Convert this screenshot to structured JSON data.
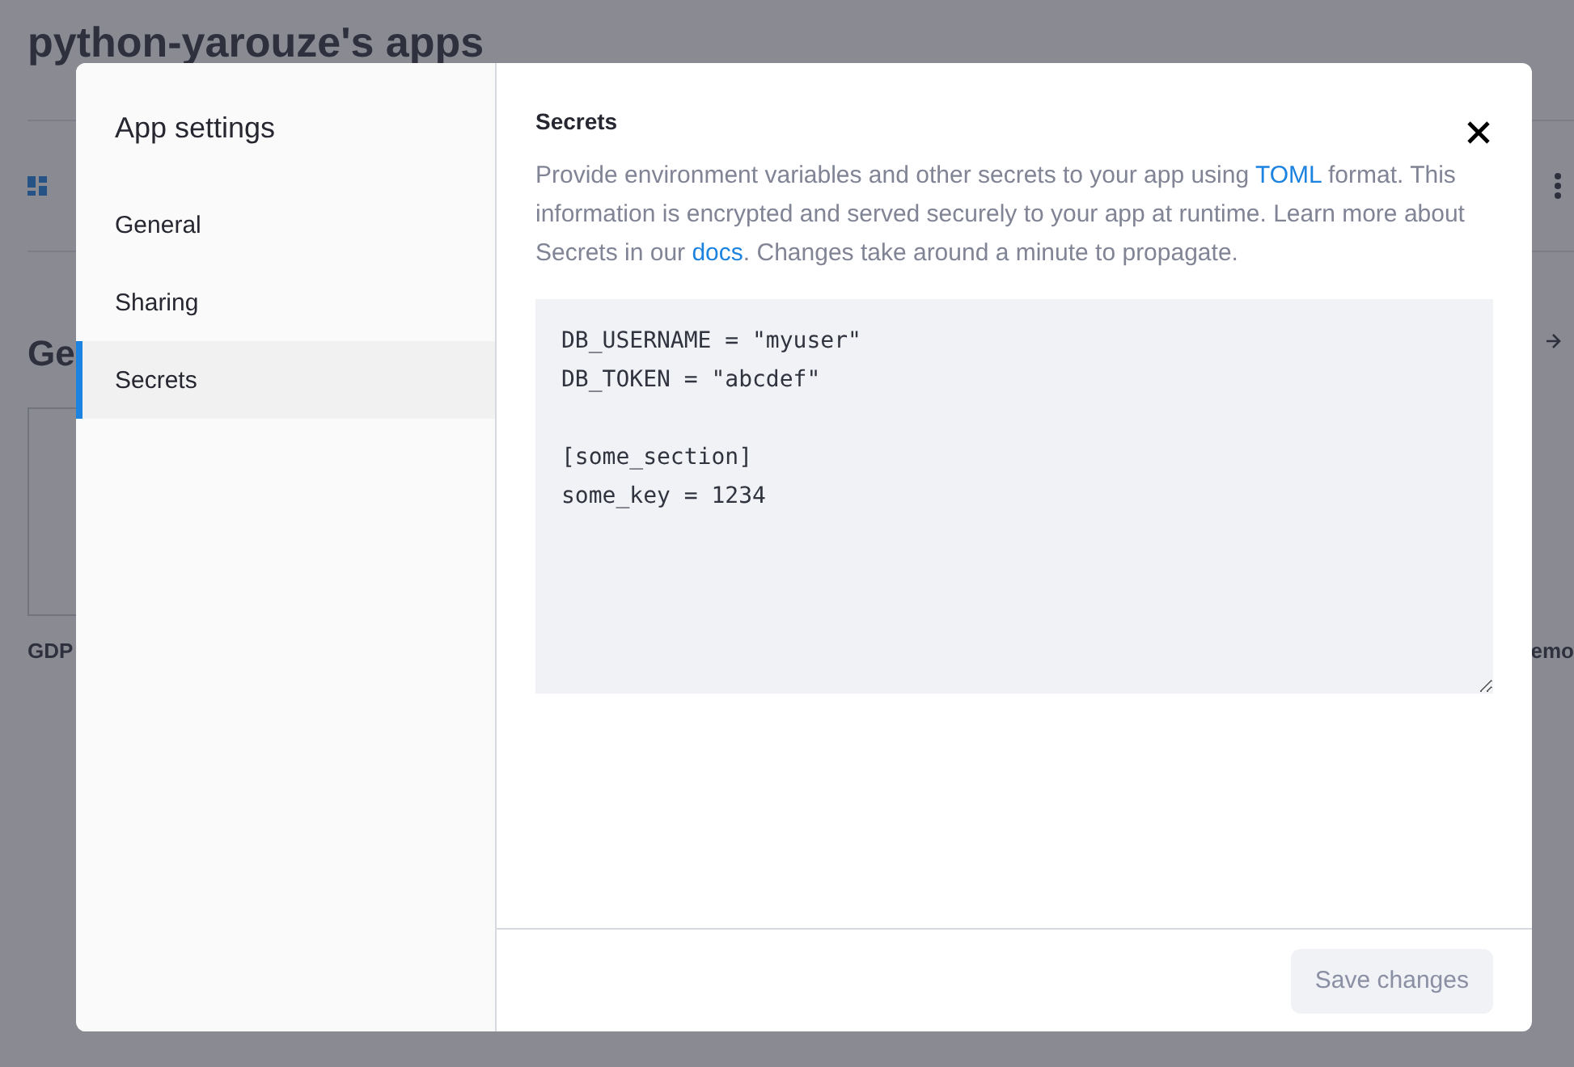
{
  "page": {
    "title": "python-yarouze's apps",
    "section_heading": "Ge",
    "card_title": "GDP",
    "card_title_right": "emo"
  },
  "modal": {
    "title": "App settings",
    "nav": [
      {
        "label": "General",
        "selected": false
      },
      {
        "label": "Sharing",
        "selected": false
      },
      {
        "label": "Secrets",
        "selected": true
      }
    ],
    "heading": "Secrets",
    "description": [
      {
        "kind": "text",
        "text": "Provide environment variables and other secrets to your app using "
      },
      {
        "kind": "link",
        "text": "TOML"
      },
      {
        "kind": "text",
        "text": " format. This information is encrypted and served securely to your app at runtime. Learn more about Secrets in our "
      },
      {
        "kind": "link",
        "text": "docs"
      },
      {
        "kind": "text",
        "text": ". Changes take around a minute to propagate."
      }
    ],
    "secrets_value": "DB_USERNAME = \"myuser\"\nDB_TOKEN = \"abcdef\"\n\n[some_section]\nsome_key = 1234",
    "save_button": {
      "label": "Save changes",
      "disabled": true
    }
  }
}
